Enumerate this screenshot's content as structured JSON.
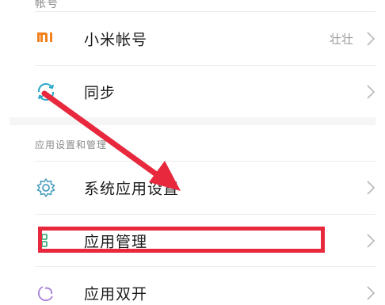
{
  "top_item": {
    "label": "帐号"
  },
  "account": {
    "label": "小米帐号",
    "value": "壮壮",
    "icon": "mi-logo-icon"
  },
  "sync": {
    "label": "同步",
    "icon": "sync-icon"
  },
  "section": {
    "header": "应用设置和管理"
  },
  "system_apps": {
    "label": "系统应用设置",
    "icon": "gear-icon"
  },
  "app_manage": {
    "label": "应用管理",
    "icon": "app-grid-icon"
  },
  "dual_apps": {
    "label": "应用双开",
    "icon": "dual-app-icon"
  },
  "colors": {
    "accent": "#f1801d",
    "annotation": "#e8283c",
    "text": "#1b1b1b",
    "muted": "#9a9a9a"
  }
}
